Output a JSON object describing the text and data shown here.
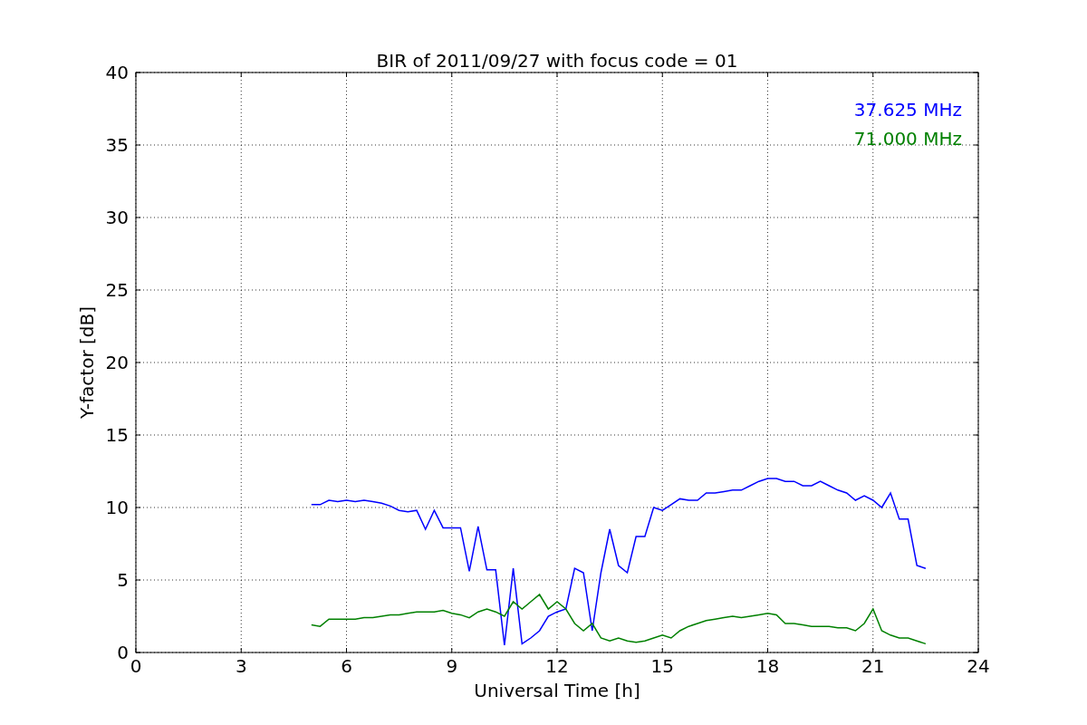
{
  "chart_data": {
    "type": "line",
    "title": "BIR of 2011/09/27 with focus code = 01",
    "xlabel": "Universal Time [h]",
    "ylabel": "Y-factor [dB]",
    "x": [
      5,
      5.25,
      5.5,
      5.75,
      6,
      6.25,
      6.5,
      6.75,
      7,
      7.25,
      7.5,
      7.75,
      8,
      8.25,
      8.5,
      8.75,
      9,
      9.25,
      9.5,
      9.75,
      10,
      10.25,
      10.5,
      10.75,
      11,
      11.25,
      11.5,
      11.75,
      12,
      12.25,
      12.5,
      12.75,
      13,
      13.25,
      13.5,
      13.75,
      14,
      14.25,
      14.5,
      14.75,
      15,
      15.25,
      15.5,
      15.75,
      16,
      16.25,
      16.5,
      16.75,
      17,
      17.25,
      17.5,
      17.75,
      18,
      18.25,
      18.5,
      18.75,
      19,
      19.25,
      19.5,
      19.75,
      20,
      20.25,
      20.5,
      20.75,
      21,
      21.25,
      21.5,
      21.75,
      22,
      22.25,
      22.5
    ],
    "series": [
      {
        "name": "37.625 MHz",
        "color": "#0000ff",
        "values": [
          10.2,
          10.2,
          10.5,
          10.4,
          10.5,
          10.4,
          10.5,
          10.4,
          10.3,
          10.1,
          9.8,
          9.7,
          9.8,
          8.5,
          9.8,
          8.6,
          8.6,
          8.6,
          5.6,
          8.7,
          5.7,
          5.7,
          0.5,
          5.8,
          0.6,
          1.0,
          1.5,
          2.5,
          2.8,
          3.0,
          5.8,
          5.5,
          1.5,
          5.5,
          8.5,
          6.0,
          5.5,
          8.0,
          8.0,
          10.0,
          9.8,
          10.2,
          10.6,
          10.5,
          10.5,
          11.0,
          11.0,
          11.1,
          11.2,
          11.2,
          11.5,
          11.8,
          12.0,
          12.0,
          11.8,
          11.8,
          11.5,
          11.5,
          11.8,
          11.5,
          11.2,
          11.0,
          10.5,
          10.8,
          10.5,
          10.0,
          11.0,
          9.2,
          9.2,
          6.0,
          5.8
        ]
      },
      {
        "name": "71.000 MHz",
        "color": "#008000",
        "values": [
          1.9,
          1.8,
          2.3,
          2.3,
          2.3,
          2.3,
          2.4,
          2.4,
          2.5,
          2.6,
          2.6,
          2.7,
          2.8,
          2.8,
          2.8,
          2.9,
          2.7,
          2.6,
          2.4,
          2.8,
          3.0,
          2.8,
          2.5,
          3.5,
          3.0,
          3.5,
          4.0,
          3.0,
          3.5,
          3.0,
          2.0,
          1.5,
          2.0,
          1.0,
          0.8,
          1.0,
          0.8,
          0.7,
          0.8,
          1.0,
          1.2,
          1.0,
          1.5,
          1.8,
          2.0,
          2.2,
          2.3,
          2.4,
          2.5,
          2.4,
          2.5,
          2.6,
          2.7,
          2.6,
          2.0,
          2.0,
          1.9,
          1.8,
          1.8,
          1.8,
          1.7,
          1.7,
          1.5,
          2.0,
          3.0,
          1.5,
          1.2,
          1.0,
          1.0,
          0.8,
          0.6
        ]
      }
    ],
    "xlim": [
      0,
      24
    ],
    "ylim": [
      0,
      40
    ],
    "xticks": [
      0,
      3,
      6,
      9,
      12,
      15,
      18,
      21,
      24
    ],
    "yticks": [
      0,
      5,
      10,
      15,
      20,
      25,
      30,
      35,
      40
    ],
    "grid": true
  }
}
